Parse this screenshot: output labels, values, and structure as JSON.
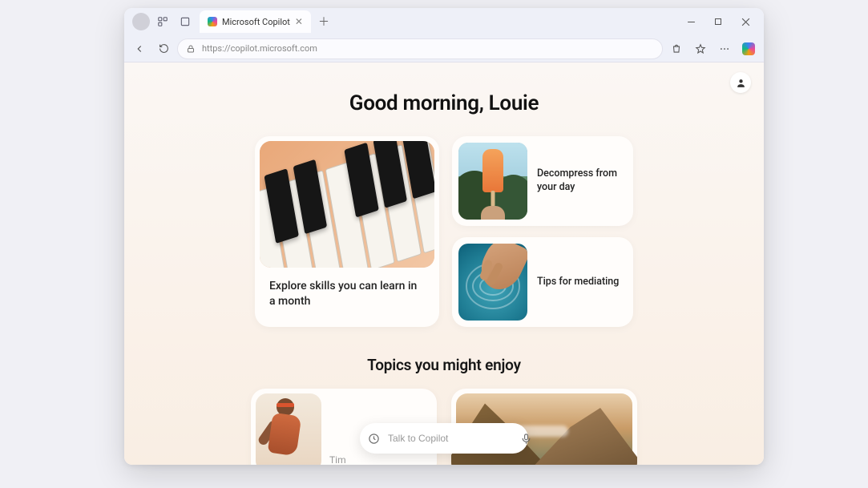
{
  "browser": {
    "tab_title": "Microsoft Copilot",
    "url": "https://copilot.microsoft.com"
  },
  "page": {
    "greeting": "Good morning, Louie",
    "card_large": {
      "label": "Explore skills you can learn in a month"
    },
    "card_small_1": {
      "label": "Decompress from your day"
    },
    "card_small_2": {
      "label": "Tips for mediating"
    },
    "section_heading": "Topics you might enjoy",
    "topic_1_hint": "Tim",
    "prompt_placeholder": "Talk to Copilot"
  }
}
